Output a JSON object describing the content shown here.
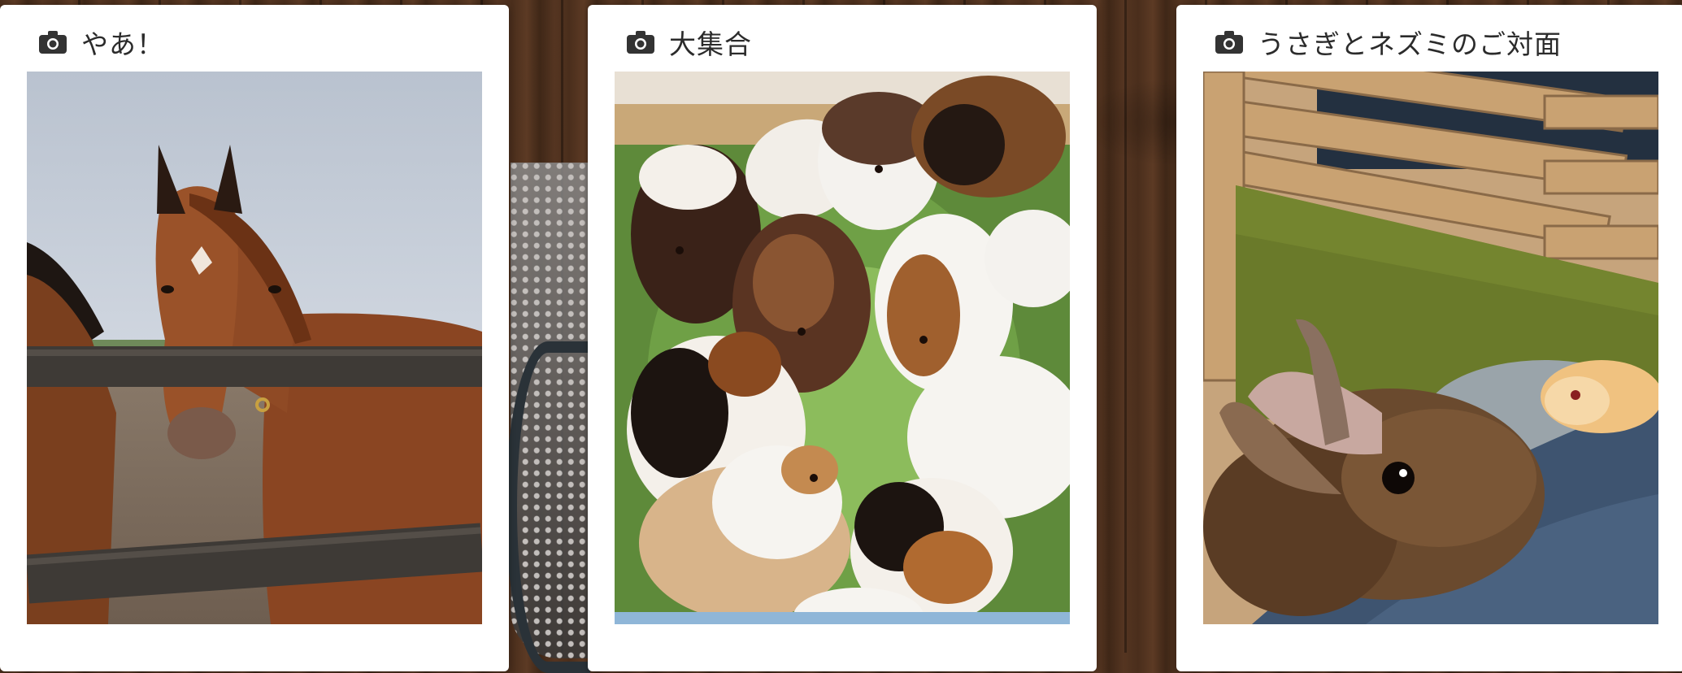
{
  "cards": [
    {
      "title": "やあ！",
      "icon": "camera-icon",
      "photo": "horse-at-fence"
    },
    {
      "title": "大集合",
      "icon": "camera-icon",
      "photo": "guinea-pigs-eating"
    },
    {
      "title": "うさぎとネズミのご対面",
      "icon": "camera-icon",
      "photo": "rabbit-and-hamster"
    }
  ],
  "colors": {
    "background_wood": "#4a2e1c",
    "card": "#ffffff",
    "title_text": "#2b2b2b"
  }
}
